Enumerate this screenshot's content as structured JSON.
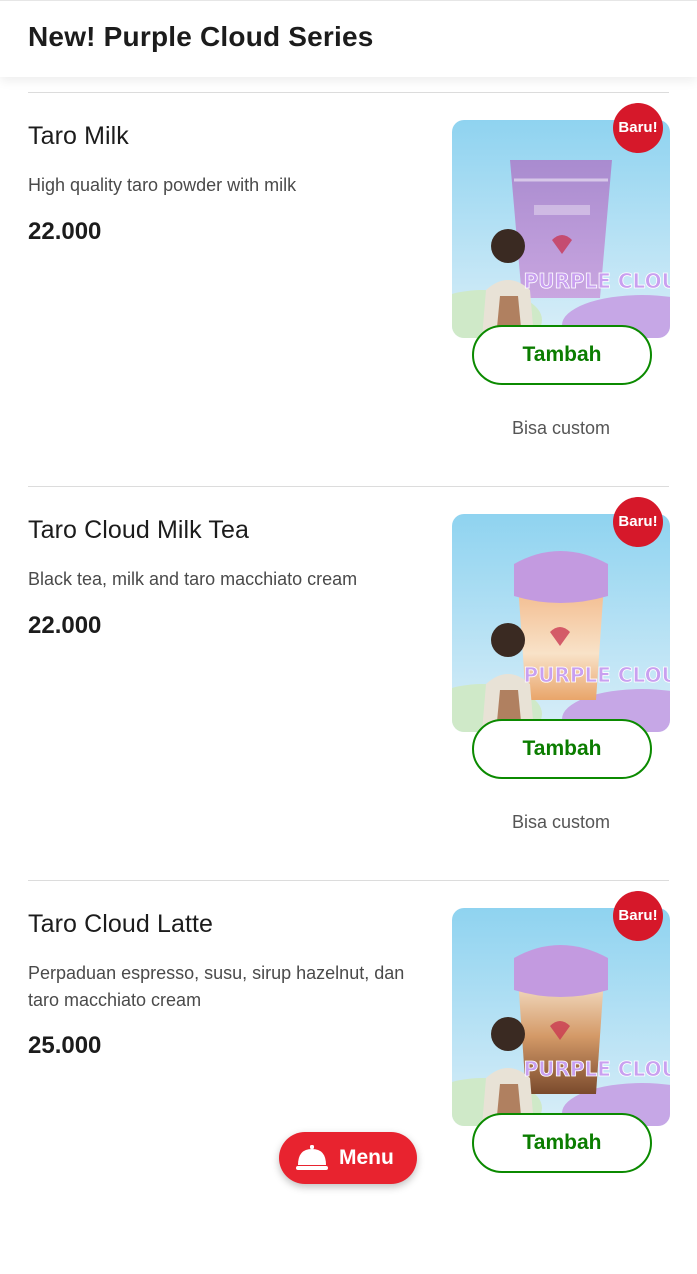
{
  "header": {
    "title": "New! Purple Cloud Series"
  },
  "items": [
    {
      "name": "Taro Milk",
      "description": "High quality taro powder with milk",
      "price": "22.000",
      "badge": "Baru!",
      "add_label": "Tambah",
      "note": "Bisa custom",
      "image_drink": "iced-taro-milk-cup",
      "image_logo": "PURPLE CLOUD"
    },
    {
      "name": "Taro Cloud Milk Tea",
      "description": "Black tea, milk and taro macchiato cream",
      "price": "22.000",
      "badge": "Baru!",
      "add_label": "Tambah",
      "note": "Bisa custom",
      "image_drink": "taro-cloud-milk-tea-cup",
      "image_logo": "PURPLE CLOUD"
    },
    {
      "name": "Taro Cloud Latte",
      "description": "Perpaduan espresso, susu, sirup hazelnut, dan taro macchiato cream",
      "price": "25.000",
      "badge": "Baru!",
      "add_label": "Tambah",
      "image_drink": "taro-cloud-latte-cup",
      "image_logo": "PURPLE CLOUD"
    }
  ],
  "bottom_nav": {
    "menu_label": "Menu",
    "menu_icon": "cloche-icon"
  },
  "colors": {
    "accent_red": "#e8232f",
    "badge_red": "#d6182a",
    "button_green": "#0b8a00",
    "taro_purple": "#b58ad8"
  }
}
